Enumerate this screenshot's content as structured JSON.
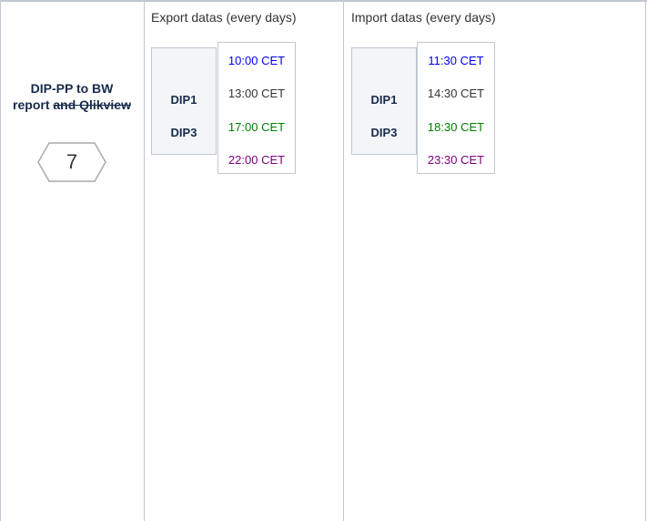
{
  "label_cell": {
    "title_line1": "DIP-PP to BW",
    "title_line2_plain": "report ",
    "title_line2_strike": "and Qlikview",
    "step_number": "7"
  },
  "export": {
    "header": "Export datas (every days)",
    "systems": [
      "DIP1",
      "DIP3"
    ],
    "times": [
      {
        "text": "10:00 CET",
        "color": "#0000ff"
      },
      {
        "text": "13:00 CET",
        "color": "#333333"
      },
      {
        "text": "17:00 CET",
        "color": "#008000"
      },
      {
        "text": "22:00 CET",
        "color": "#800080"
      }
    ]
  },
  "import": {
    "header": "Import datas (every days)",
    "systems": [
      "DIP1",
      "DIP3"
    ],
    "times": [
      {
        "text": "11:30 CET",
        "color": "#0000ff"
      },
      {
        "text": "14:30 CET",
        "color": "#333333"
      },
      {
        "text": "18:30 CET",
        "color": "#008000"
      },
      {
        "text": "23:30 CET",
        "color": "#800080"
      }
    ]
  },
  "colors": {
    "border": "#c1c7d0",
    "box_bg": "#f4f5f7",
    "blue": "#0000ff",
    "green": "#008000",
    "purple": "#800080"
  }
}
